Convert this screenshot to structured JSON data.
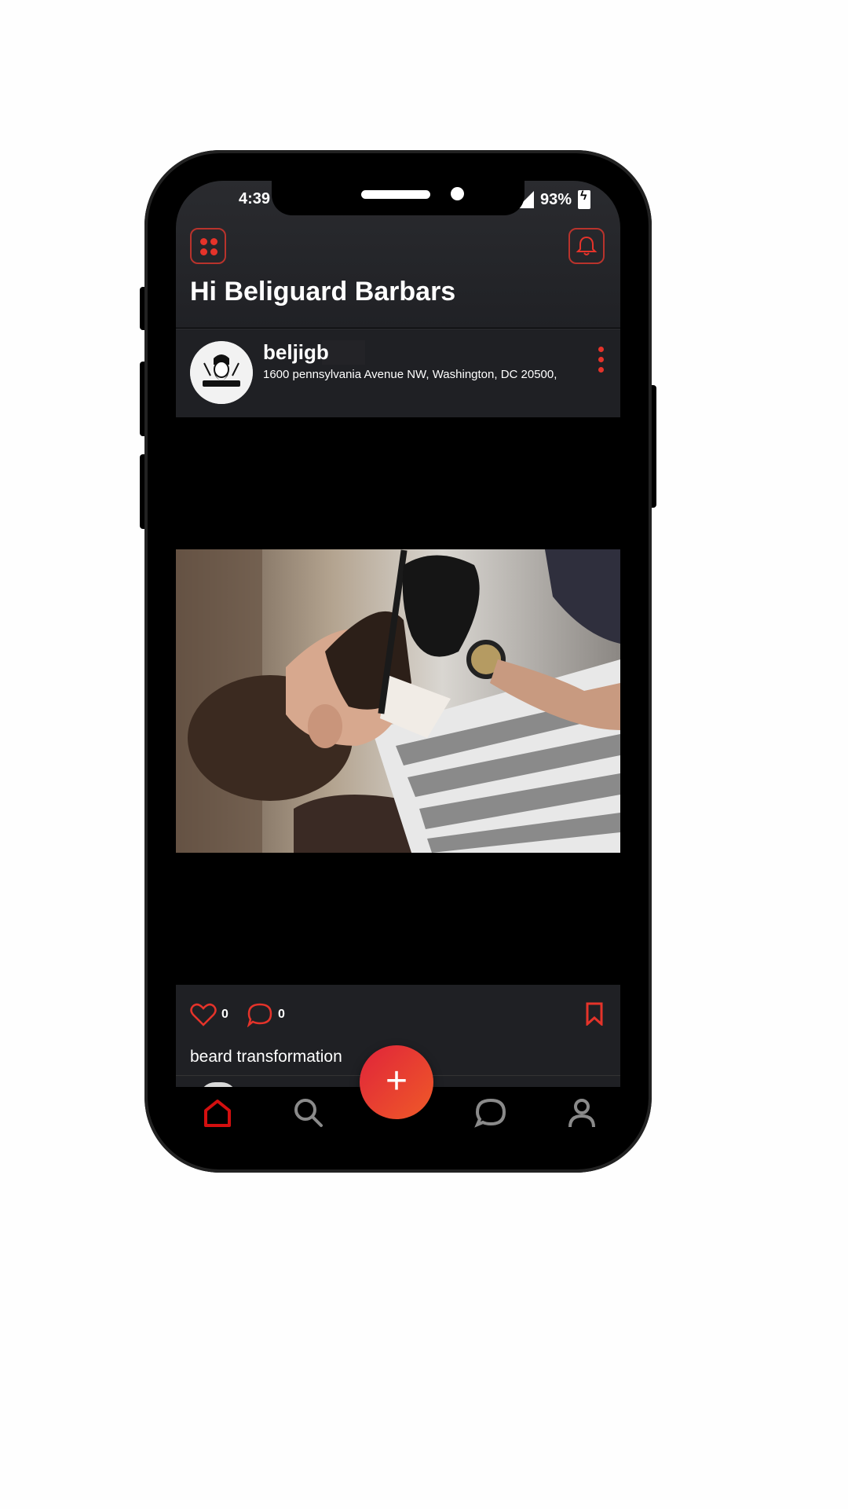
{
  "status_bar": {
    "time": "4:39",
    "battery_percent": "93%"
  },
  "header": {
    "greeting": "Hi Beliguard Barbars",
    "menu_icon": "grid-dots-icon",
    "notification_icon": "bell-icon"
  },
  "post": {
    "username": "beljigb",
    "address": "1600 pennsylvania Avenue NW, Washington, DC 20500,",
    "likes": "0",
    "comments": "0",
    "caption": "beard transformation",
    "photo": "barber-shaving-beard-photo"
  },
  "nav": {
    "items": [
      "home-icon",
      "search-icon",
      "add-icon",
      "chat-icon",
      "profile-icon"
    ],
    "active": "home",
    "fab_label": "+"
  },
  "colors": {
    "accent": "#e5332a",
    "header_bg": "#2a2b2f",
    "card_bg": "#1f2024",
    "nav_inactive": "#8a8a8a"
  }
}
